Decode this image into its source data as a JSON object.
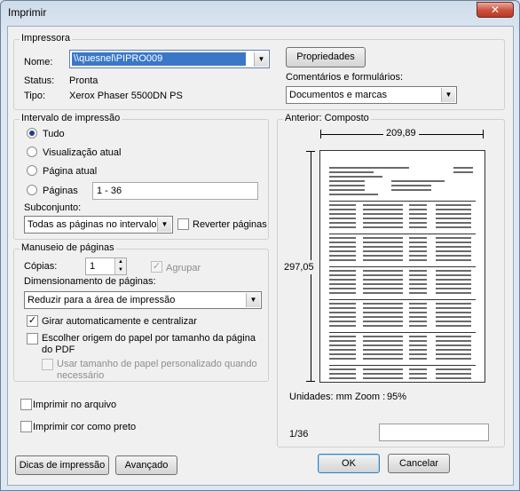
{
  "window": {
    "title": "Imprimir",
    "close_glyph": "✕"
  },
  "printer": {
    "group_title": "Impressora",
    "name_label": "Nome:",
    "name_value": "\\\\quesnel\\PIPRO009",
    "properties_button": "Propriedades",
    "status_label": "Status:",
    "status_value": "Pronta",
    "type_label": "Tipo:",
    "type_value": "Xerox Phaser 5500DN PS",
    "comments_label": "Comentários e formulários:",
    "comments_value": "Documentos e marcas"
  },
  "range": {
    "group_title": "Intervalo de impressão",
    "options": [
      "Tudo",
      "Visualização atual",
      "Página atual",
      "Páginas"
    ],
    "selected": "Tudo",
    "pages_value": "1 - 36",
    "subset_label": "Subconjunto:",
    "subset_value": "Todas as páginas no intervalo",
    "reverse_label": "Reverter páginas"
  },
  "handling": {
    "group_title": "Manuseio de páginas",
    "copies_label": "Cópias:",
    "copies_value": "1",
    "collate_label": "Agrupar",
    "scaling_label": "Dimensionamento de páginas:",
    "scaling_value": "Reduzir para a área de impressão",
    "auto_rotate_label": "Girar automaticamente e centralizar",
    "auto_rotate_checked": true,
    "choose_source_label_1": "Escolher origem do papel por tamanho da página",
    "choose_source_label_2": "do PDF",
    "custom_size_label_1": "Usar tamanho de papel personalizado quando",
    "custom_size_label_2": "necessário"
  },
  "options": {
    "print_to_file": "Imprimir no arquivo",
    "print_bw": "Imprimir cor como preto"
  },
  "preview": {
    "group_title": "Anterior: Composto",
    "width_value": "209,89",
    "height_value": "297,05",
    "units_label": "Unidades: mm Zoom :",
    "zoom_value": "95%",
    "page_indicator": "1/36"
  },
  "buttons": {
    "tips": "Dicas de impressão",
    "advanced": "Avançado",
    "ok": "OK",
    "cancel": "Cancelar"
  },
  "icons": {
    "dropdown_arrow": "▼",
    "spin_up": "▲",
    "spin_down": "▼",
    "check": "✓"
  }
}
